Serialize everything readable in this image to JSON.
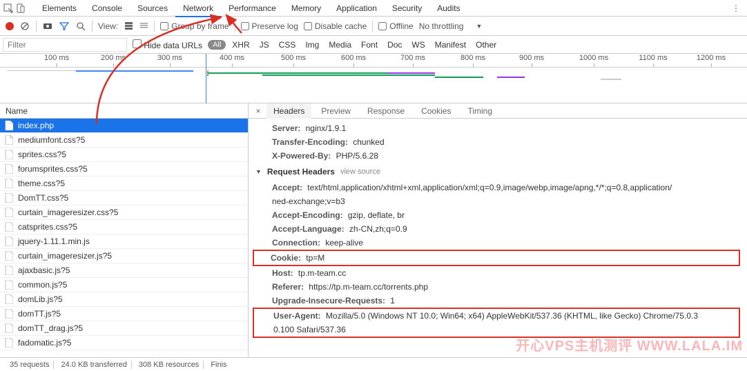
{
  "tabs": {
    "elements": "Elements",
    "console": "Console",
    "sources": "Sources",
    "network": "Network",
    "performance": "Performance",
    "memory": "Memory",
    "application": "Application",
    "security": "Security",
    "audits": "Audits"
  },
  "toolbar": {
    "view_label": "View:",
    "group_by_frame": "Group by frame",
    "preserve_log": "Preserve log",
    "disable_cache": "Disable cache",
    "offline": "Offline",
    "throttling": "No throttling"
  },
  "filter": {
    "placeholder": "Filter",
    "hide_data_urls": "Hide data URLs",
    "types": [
      "All",
      "XHR",
      "JS",
      "CSS",
      "Img",
      "Media",
      "Font",
      "Doc",
      "WS",
      "Manifest",
      "Other"
    ]
  },
  "timeline": {
    "ticks": [
      "100 ms",
      "200 ms",
      "300 ms",
      "400 ms",
      "500 ms",
      "600 ms",
      "700 ms",
      "800 ms",
      "900 ms",
      "1000 ms",
      "1100 ms",
      "1200 ms"
    ]
  },
  "left": {
    "header": "Name",
    "items": [
      "index.php",
      "mediumfont.css?5",
      "sprites.css?5",
      "forumsprites.css?5",
      "theme.css?5",
      "DomTT.css?5",
      "curtain_imageresizer.css?5",
      "catsprites.css?5",
      "jquery-1.11.1.min.js",
      "curtain_imageresizer.js?5",
      "ajaxbasic.js?5",
      "common.js?5",
      "domLib.js?5",
      "domTT.js?5",
      "domTT_drag.js?5",
      "fadomatic.js?5"
    ]
  },
  "right": {
    "tabs": {
      "headers": "Headers",
      "preview": "Preview",
      "response": "Response",
      "cookies": "Cookies",
      "timing": "Timing"
    },
    "response_headers": {
      "server_k": "Server:",
      "server_v": "nginx/1.9.1",
      "te_k": "Transfer-Encoding:",
      "te_v": "chunked",
      "xp_k": "X-Powered-By:",
      "xp_v": "PHP/5.6.28"
    },
    "request_section": "Request Headers",
    "view_source": "view source",
    "request_headers": {
      "accept_k": "Accept:",
      "accept_v": "text/html,application/xhtml+xml,application/xml;q=0.9,image/webp,image/apng,*/*;q=0.8,application/",
      "accept_v2": "ned-exchange;v=b3",
      "ae_k": "Accept-Encoding:",
      "ae_v": "gzip, deflate, br",
      "al_k": "Accept-Language:",
      "al_v": "zh-CN,zh;q=0.9",
      "conn_k": "Connection:",
      "conn_v": "keep-alive",
      "cookie_k": "Cookie:",
      "cookie_v": "tp=M",
      "host_k": "Host:",
      "host_v": "tp.m-team.cc",
      "ref_k": "Referer:",
      "ref_v": "https://tp.m-team.cc/torrents.php",
      "uir_k": "Upgrade-Insecure-Requests:",
      "uir_v": "1",
      "ua_k": "User-Agent:",
      "ua_v": "Mozilla/5.0 (Windows NT 10.0; Win64; x64) AppleWebKit/537.36 (KHTML, like Gecko) Chrome/75.0.3",
      "ua_v2": "0.100 Safari/537.36"
    }
  },
  "status": {
    "requests": "35 requests",
    "transferred": "24.0 KB transferred",
    "resources": "308 KB resources",
    "finish": "Finis"
  },
  "watermark": "开心VPS主机测评 WWW.LALA.IM"
}
